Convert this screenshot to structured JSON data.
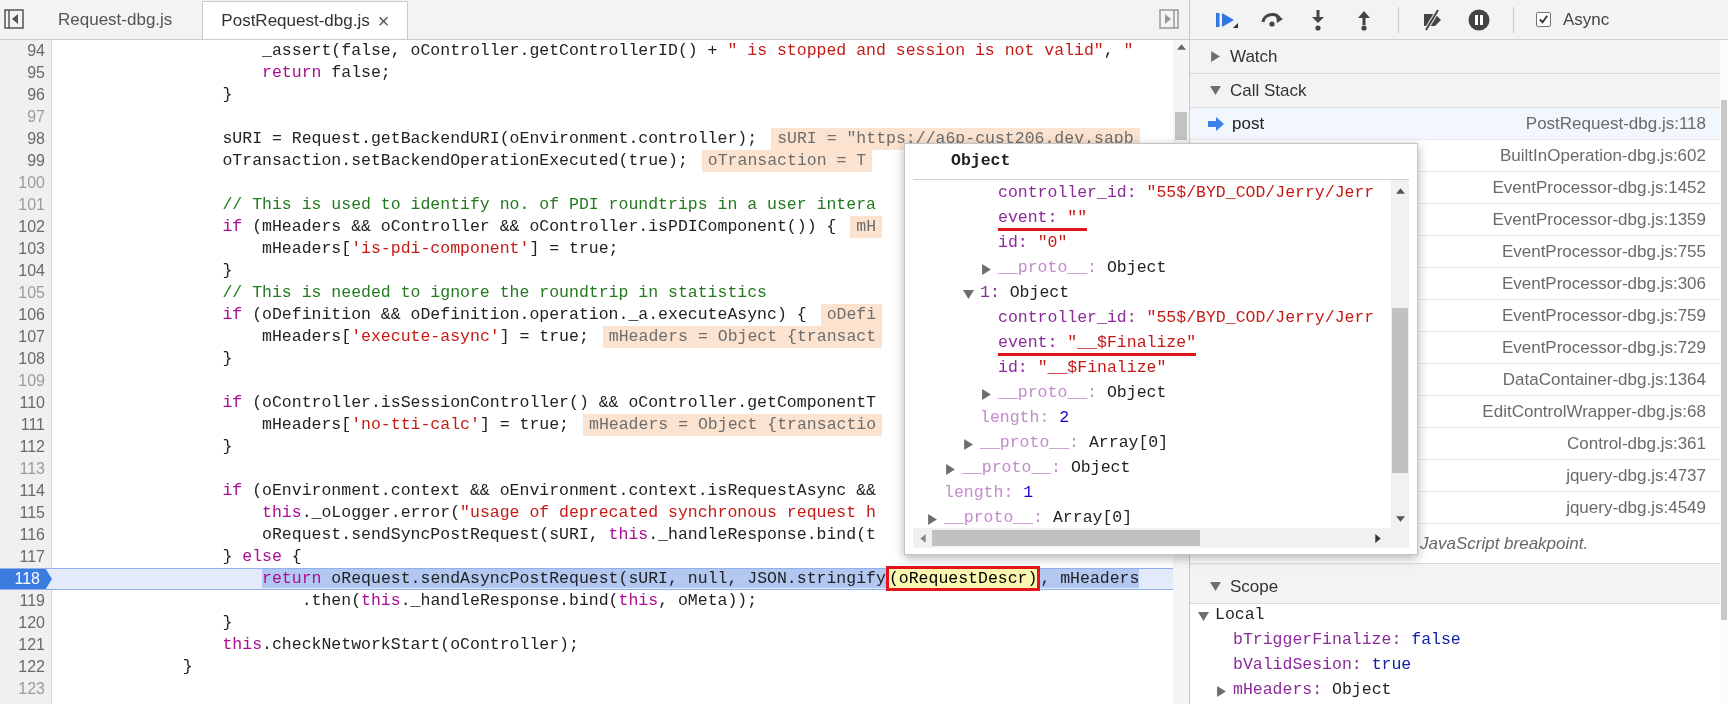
{
  "tabs": [
    {
      "label": "Request-dbg.js",
      "selected": false
    },
    {
      "label": "PostRequest-dbg.js",
      "selected": true,
      "close": "×"
    }
  ],
  "code_lines": [
    {
      "number": "94",
      "dimmed": false,
      "current": false,
      "segments": [
        {
          "kind": "plain",
          "text": "                    _assert(false, oController.getControllerID() + "
        },
        {
          "kind": "string",
          "text": "\" is stopped and session is not valid\""
        },
        {
          "kind": "plain",
          "text": ", "
        },
        {
          "kind": "string",
          "text": "\""
        }
      ]
    },
    {
      "number": "95",
      "dimmed": false,
      "current": false,
      "segments": [
        {
          "kind": "keyword",
          "text": "                    return"
        },
        {
          "kind": "plain",
          "text": " false;"
        }
      ]
    },
    {
      "number": "96",
      "dimmed": false,
      "current": false,
      "segments": [
        {
          "kind": "plain",
          "text": "                }"
        }
      ]
    },
    {
      "number": "97",
      "dimmed": true,
      "current": false
    },
    {
      "number": "98",
      "dimmed": false,
      "current": false,
      "segments": [
        {
          "kind": "plain",
          "text": "                sURI = Request.getBackendURI(oEnvironment.controller);"
        }
      ],
      "inline_value": "sURI = \"https://a6p-cust206.dev.sapb"
    },
    {
      "number": "99",
      "dimmed": false,
      "current": false,
      "segments": [
        {
          "kind": "plain",
          "text": "                oTransaction.setBackendOperationExecuted(true);"
        }
      ],
      "inline_value": "oTransaction = T"
    },
    {
      "number": "100",
      "dimmed": true,
      "current": false
    },
    {
      "number": "101",
      "dimmed": true,
      "current": false,
      "segments": [
        {
          "kind": "comment",
          "text": "                // This is used to identify no. of PDI roundtrips in a user intera"
        }
      ]
    },
    {
      "number": "102",
      "dimmed": false,
      "current": false,
      "segments": [
        {
          "kind": "keyword",
          "text": "                if"
        },
        {
          "kind": "plain",
          "text": " (mHeaders && oController && oController.isPDIComponent()) {"
        }
      ],
      "inline_value": "mH"
    },
    {
      "number": "103",
      "dimmed": false,
      "current": false,
      "segments": [
        {
          "kind": "plain",
          "text": "                    mHeaders["
        },
        {
          "kind": "string",
          "text": "'is-pdi-component'"
        },
        {
          "kind": "plain",
          "text": "] = true;"
        }
      ]
    },
    {
      "number": "104",
      "dimmed": false,
      "current": false,
      "segments": [
        {
          "kind": "plain",
          "text": "                }"
        }
      ]
    },
    {
      "number": "105",
      "dimmed": true,
      "current": false,
      "segments": [
        {
          "kind": "comment",
          "text": "                // This is needed to ignore the roundtrip in statistics"
        }
      ]
    },
    {
      "number": "106",
      "dimmed": false,
      "current": false,
      "segments": [
        {
          "kind": "keyword",
          "text": "                if"
        },
        {
          "kind": "plain",
          "text": " (oDefinition && oDefinition.operation._a.executeAsync) {"
        }
      ],
      "inline_value": "oDefi"
    },
    {
      "number": "107",
      "dimmed": false,
      "current": false,
      "segments": [
        {
          "kind": "plain",
          "text": "                    mHeaders["
        },
        {
          "kind": "string",
          "text": "'execute-async'"
        },
        {
          "kind": "plain",
          "text": "] = true;"
        }
      ],
      "inline_value": "mHeaders = Object {transact"
    },
    {
      "number": "108",
      "dimmed": false,
      "current": false,
      "segments": [
        {
          "kind": "plain",
          "text": "                }"
        }
      ]
    },
    {
      "number": "109",
      "dimmed": true,
      "current": false
    },
    {
      "number": "110",
      "dimmed": false,
      "current": false,
      "segments": [
        {
          "kind": "keyword",
          "text": "                if"
        },
        {
          "kind": "plain",
          "text": " (oController.isSessionController() && oController.getComponentT"
        }
      ]
    },
    {
      "number": "111",
      "dimmed": false,
      "current": false,
      "segments": [
        {
          "kind": "plain",
          "text": "                    mHeaders["
        },
        {
          "kind": "string",
          "text": "'no-tti-calc'"
        },
        {
          "kind": "plain",
          "text": "] = true;"
        }
      ],
      "inline_value": "mHeaders = Object {transactio"
    },
    {
      "number": "112",
      "dimmed": false,
      "current": false,
      "segments": [
        {
          "kind": "plain",
          "text": "                }"
        }
      ]
    },
    {
      "number": "113",
      "dimmed": true,
      "current": false
    },
    {
      "number": "114",
      "dimmed": false,
      "current": false,
      "segments": [
        {
          "kind": "keyword",
          "text": "                if"
        },
        {
          "kind": "plain",
          "text": " (oEnvironment.context && oEnvironment.context.isRequestAsync &&"
        }
      ]
    },
    {
      "number": "115",
      "dimmed": false,
      "current": false,
      "segments": [
        {
          "kind": "keyword",
          "text": "                    this"
        },
        {
          "kind": "plain",
          "text": "._oLogger.error("
        },
        {
          "kind": "string",
          "text": "\"usage of deprecated synchronous request h"
        }
      ]
    },
    {
      "number": "116",
      "dimmed": false,
      "current": false,
      "segments": [
        {
          "kind": "plain",
          "text": "                    oRequest.sendSyncPostRequest(sURI, "
        },
        {
          "kind": "keyword",
          "text": "this"
        },
        {
          "kind": "plain",
          "text": "._handleResponse.bind(t"
        }
      ]
    },
    {
      "number": "117",
      "dimmed": false,
      "current": false,
      "segments": [
        {
          "kind": "plain",
          "text": "                } "
        },
        {
          "kind": "keyword",
          "text": "else"
        },
        {
          "kind": "plain",
          "text": " {"
        }
      ]
    },
    {
      "number": "118",
      "dimmed": false,
      "current": true,
      "segments": [
        {
          "kind": "keyword",
          "text": "                    return"
        },
        {
          "kind": "plain",
          "text": " oRequest.sendAsyncPostRequest(sURI, null, JSON.stringify"
        },
        {
          "kind": "hovered",
          "text": "(oRequestDescr)",
          "annotated": true
        },
        {
          "kind": "plain",
          "text": ", mHeaders"
        }
      ]
    },
    {
      "number": "119",
      "dimmed": false,
      "current": false,
      "segments": [
        {
          "kind": "plain",
          "text": "                        .then("
        },
        {
          "kind": "keyword",
          "text": "this"
        },
        {
          "kind": "plain",
          "text": "._handleResponse.bind("
        },
        {
          "kind": "keyword",
          "text": "this"
        },
        {
          "kind": "plain",
          "text": ", oMeta));"
        }
      ]
    },
    {
      "number": "120",
      "dimmed": false,
      "current": false,
      "segments": [
        {
          "kind": "plain",
          "text": "                }"
        }
      ]
    },
    {
      "number": "121",
      "dimmed": false,
      "current": false,
      "segments": [
        {
          "kind": "keyword",
          "text": "                this"
        },
        {
          "kind": "plain",
          "text": ".checkNetworkStart(oController);"
        }
      ]
    },
    {
      "number": "122",
      "dimmed": false,
      "current": false,
      "segments": [
        {
          "kind": "plain",
          "text": "            }"
        }
      ]
    },
    {
      "number": "123",
      "dimmed": true,
      "current": false
    }
  ],
  "popup": {
    "title": "Object",
    "tree": [
      {
        "children": [
          {
            "children": [
              {
                "children": [
                  {
                    "key": "controller_id:",
                    "value": "\"55$/BYD_COD/Jerry/Jerr",
                    "kind": "string",
                    "internal": false,
                    "underlined": false
                  },
                  {
                    "key": "event:",
                    "value": "\"\"",
                    "kind": "string",
                    "internal": false,
                    "underlined": true
                  },
                  {
                    "key": "id:",
                    "value": "\"0\"",
                    "kind": "string",
                    "internal": false,
                    "underlined": false
                  },
                  {
                    "key": "__proto__:",
                    "value": "Object",
                    "kind": "object",
                    "internal": true,
                    "underlined": false,
                    "expanded": false
                  }
                ]
              },
              {
                "key": "1:",
                "value": "Object",
                "kind": "object",
                "internal": false,
                "underlined": false,
                "expanded": true,
                "children": [
                  {
                    "key": "controller_id:",
                    "value": "\"55$/BYD_COD/Jerry/Jerr",
                    "kind": "string",
                    "internal": false,
                    "underlined": false
                  },
                  {
                    "key": "event:",
                    "value": "\"__$Finalize\"",
                    "kind": "string",
                    "internal": false,
                    "underlined": true
                  },
                  {
                    "key": "id:",
                    "value": "\"__$Finalize\"",
                    "kind": "string",
                    "internal": false,
                    "underlined": false
                  },
                  {
                    "key": "__proto__:",
                    "value": "Object",
                    "kind": "object",
                    "internal": true,
                    "underlined": false,
                    "expanded": false
                  }
                ]
              },
              {
                "key": "length:",
                "value": "2",
                "kind": "number",
                "internal": true,
                "underlined": false
              },
              {
                "key": "__proto__:",
                "value": "Array[0]",
                "kind": "object",
                "internal": true,
                "underlined": false,
                "expanded": false
              }
            ]
          },
          {
            "key": "__proto__:",
            "value": "Object",
            "kind": "object",
            "internal": true,
            "underlined": false,
            "expanded": false
          }
        ]
      },
      {
        "key": "length:",
        "value": "1",
        "kind": "number",
        "internal": true,
        "underlined": false
      },
      {
        "key": "__proto__:",
        "value": "Array[0]",
        "kind": "object",
        "internal": true,
        "underlined": false,
        "expanded": false
      }
    ]
  },
  "toolbar": {
    "async": {
      "label": "Async",
      "checked": true
    }
  },
  "watch": {
    "title": "Watch",
    "expanded": false
  },
  "call_stack": {
    "title": "Call Stack",
    "expanded": true,
    "frames": [
      {
        "name": "post",
        "location": "PostRequest-dbg.js:118",
        "selected": true
      },
      {
        "location": "BuiltInOperation-dbg.js:602",
        "selected": false
      },
      {
        "location": "EventProcessor-dbg.js:1452",
        "selected": false
      },
      {
        "location": "EventProcessor-dbg.js:1359",
        "selected": false
      },
      {
        "location": "EventProcessor-dbg.js:755",
        "selected": false
      },
      {
        "location": "EventProcessor-dbg.js:306",
        "selected": false
      },
      {
        "location": "EventProcessor-dbg.js:759",
        "selected": false
      },
      {
        "location": "EventProcessor-dbg.js:729",
        "selected": false
      },
      {
        "location": "DataContainer-dbg.js:1364",
        "selected": false
      },
      {
        "location": "EditControlWrapper-dbg.js:68",
        "selected": false
      },
      {
        "location": "Control-dbg.js:361",
        "selected": false
      },
      {
        "location": "jquery-dbg.js:4737",
        "selected": false
      },
      {
        "location": "jquery-dbg.js:4549",
        "selected": false
      }
    ],
    "message": "JavaScript breakpoint."
  },
  "scope": {
    "title": "Scope",
    "expanded": true,
    "tree": [
      {
        "key": "Local",
        "kind": "scope",
        "internal": false,
        "underlined": false,
        "expanded": true,
        "children": [
          {
            "key": "bTriggerFinalize:",
            "value": "false",
            "kind": "boolean",
            "internal": false,
            "underlined": false
          },
          {
            "key": "bValidSesion:",
            "value": "true",
            "kind": "boolean",
            "internal": false,
            "underlined": false
          },
          {
            "key": "mHeaders:",
            "value": "Object",
            "kind": "object",
            "internal": false,
            "underlined": false,
            "expanded": false
          }
        ]
      }
    ]
  }
}
